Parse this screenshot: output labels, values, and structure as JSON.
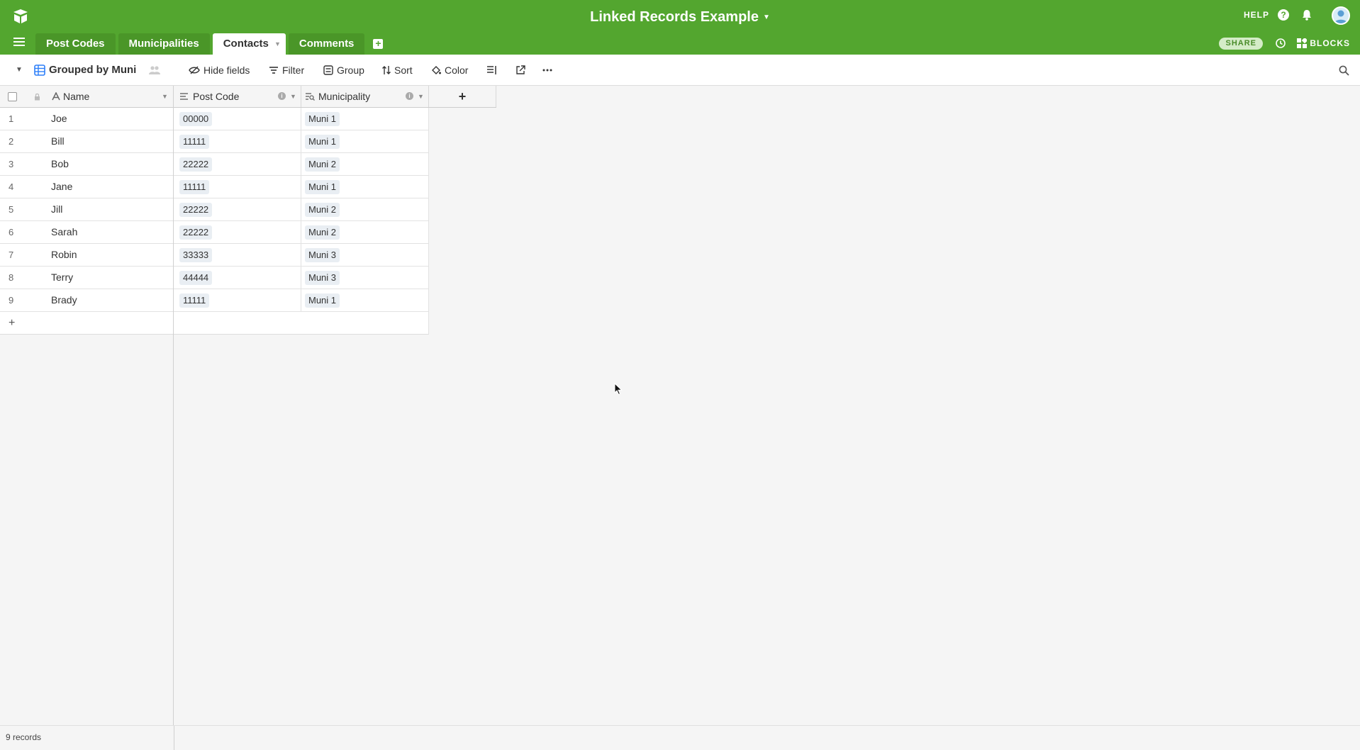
{
  "app": {
    "base_title": "Linked Records Example",
    "help_label": "HELP",
    "share_label": "SHARE",
    "blocks_label": "BLOCKS"
  },
  "tabs": [
    {
      "label": "Post Codes",
      "active": false
    },
    {
      "label": "Municipalities",
      "active": false
    },
    {
      "label": "Contacts",
      "active": true
    },
    {
      "label": "Comments",
      "active": false
    }
  ],
  "toolbar": {
    "view_name": "Grouped by Muni",
    "hide_fields": "Hide fields",
    "filter": "Filter",
    "group": "Group",
    "sort": "Sort",
    "color": "Color"
  },
  "columns": {
    "name": "Name",
    "post_code": "Post Code",
    "municipality": "Municipality",
    "add": "+"
  },
  "rows": [
    {
      "num": "1",
      "name": "Joe",
      "post_code": "00000",
      "municipality": "Muni 1"
    },
    {
      "num": "2",
      "name": "Bill",
      "post_code": "11111",
      "municipality": "Muni 1"
    },
    {
      "num": "3",
      "name": "Bob",
      "post_code": "22222",
      "municipality": "Muni 2"
    },
    {
      "num": "4",
      "name": "Jane",
      "post_code": "11111",
      "municipality": "Muni 1"
    },
    {
      "num": "5",
      "name": "Jill",
      "post_code": "22222",
      "municipality": "Muni 2"
    },
    {
      "num": "6",
      "name": "Sarah",
      "post_code": "22222",
      "municipality": "Muni 2"
    },
    {
      "num": "7",
      "name": "Robin",
      "post_code": "33333",
      "municipality": "Muni 3"
    },
    {
      "num": "8",
      "name": "Terry",
      "post_code": "44444",
      "municipality": "Muni 3"
    },
    {
      "num": "9",
      "name": "Brady",
      "post_code": "11111",
      "municipality": "Muni 1"
    }
  ],
  "add_row_label": "+",
  "footer": {
    "records": "9 records"
  },
  "colors": {
    "brand": "#53a62f",
    "accent": "#2d7ff9"
  }
}
